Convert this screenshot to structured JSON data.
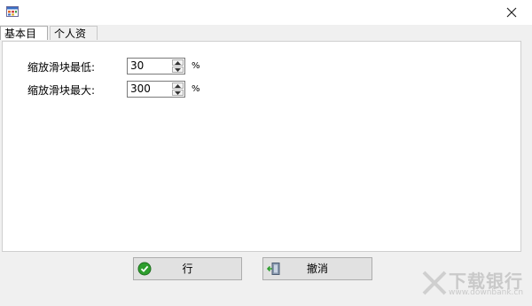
{
  "window": {
    "title": "",
    "app_icon": "calendar-icon",
    "close_icon": "close-icon"
  },
  "tabs": [
    {
      "label": "基本目录",
      "active": true
    },
    {
      "label": "个人资料",
      "active": false
    }
  ],
  "form": {
    "min_label": "缩放滑块最低:",
    "min_value": "30",
    "min_unit": "%",
    "max_label": "缩放滑块最大:",
    "max_value": "300",
    "max_unit": "%"
  },
  "buttons": {
    "ok_label": "行",
    "ok_icon": "check-icon",
    "cancel_label": "撤消",
    "cancel_icon": "exit-icon"
  },
  "watermark": {
    "text": "下载银行",
    "sub": "www.downbank.cn"
  },
  "colors": {
    "dialog_bg": "#f0f0f0",
    "content_bg": "#ffffff",
    "ok_icon_green": "#2e9e2e"
  }
}
